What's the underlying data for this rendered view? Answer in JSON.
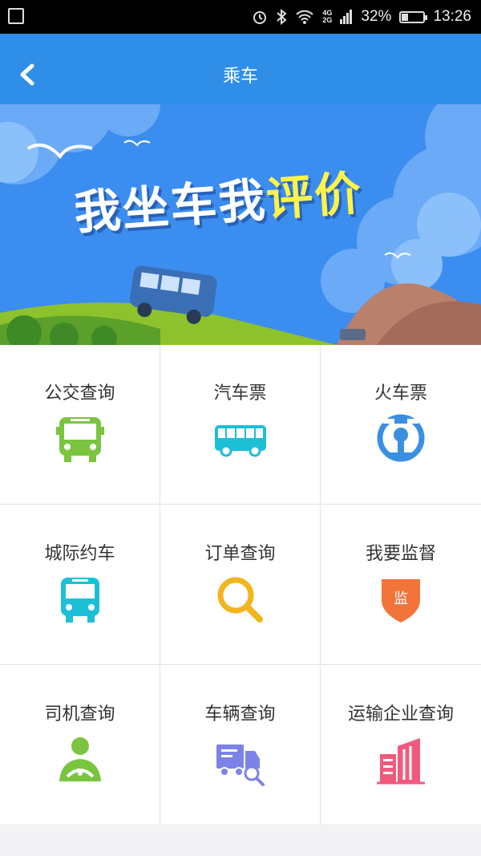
{
  "status_bar": {
    "network": "4G\n2G",
    "battery": "32%",
    "battery_level": 0.32,
    "time": "13:26",
    "icons": [
      "screenshot-icon",
      "alarm-icon",
      "bluetooth-icon",
      "wifi-icon",
      "signal-icon",
      "battery-icon"
    ]
  },
  "nav": {
    "title": "乘车",
    "back_icon": "back-chevron-icon"
  },
  "banner": {
    "title_a": "我坐车我",
    "title_b": "评价"
  },
  "grid": [
    {
      "label": "公交查询",
      "icon": "bus-icon",
      "color": "#7ac43f"
    },
    {
      "label": "汽车票",
      "icon": "coach-icon",
      "color": "#1dbfd6"
    },
    {
      "label": "火车票",
      "icon": "railway-icon",
      "color": "#3b8fe0"
    },
    {
      "label": "城际约车",
      "icon": "intercity-bus-icon",
      "color": "#1dbfd6"
    },
    {
      "label": "订单查询",
      "icon": "search-icon",
      "color": "#f2b51e"
    },
    {
      "label": "我要监督",
      "icon": "shield-icon",
      "color": "#f2743a",
      "badge": "监"
    },
    {
      "label": "司机查询",
      "icon": "driver-icon",
      "color": "#7ac43f"
    },
    {
      "label": "车辆查询",
      "icon": "truck-search-icon",
      "color": "#7b83e8"
    },
    {
      "label": "运输企业查询",
      "icon": "building-icon",
      "color": "#f25a7d"
    }
  ]
}
